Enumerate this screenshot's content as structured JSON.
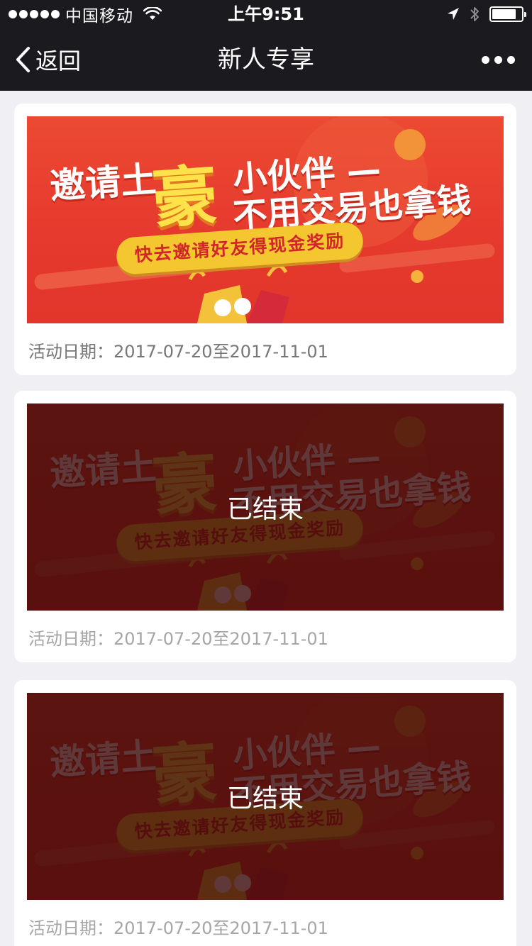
{
  "status_bar": {
    "carrier": "中国移动",
    "time": "上午9:51",
    "signal_bars": 5,
    "battery_level": 0.82
  },
  "nav": {
    "back_label": "返回",
    "title": "新人专享"
  },
  "colors": {
    "bar_bg": "#1b1b1f",
    "page_bg": "#efeff4",
    "banner_red": "#e63a2e",
    "banner_yellow": "#f4c62f",
    "overlay": "#370808"
  },
  "banner": {
    "line_invite": "邀请土",
    "line_hao": "豪",
    "line_partner": "小伙伴 —",
    "line_money": "不用交易也拿钱",
    "pill_text": "快去邀请好友得现金奖励"
  },
  "cards": [
    {
      "date_label": "活动日期：",
      "date_range": "2017-07-20至2017-11-01",
      "status": ""
    },
    {
      "date_label": "活动日期：",
      "date_range": "2017-07-20至2017-11-01",
      "status": "已结束"
    },
    {
      "date_label": "活动日期：",
      "date_range": "2017-07-20至2017-11-01",
      "status": "已结束"
    }
  ]
}
